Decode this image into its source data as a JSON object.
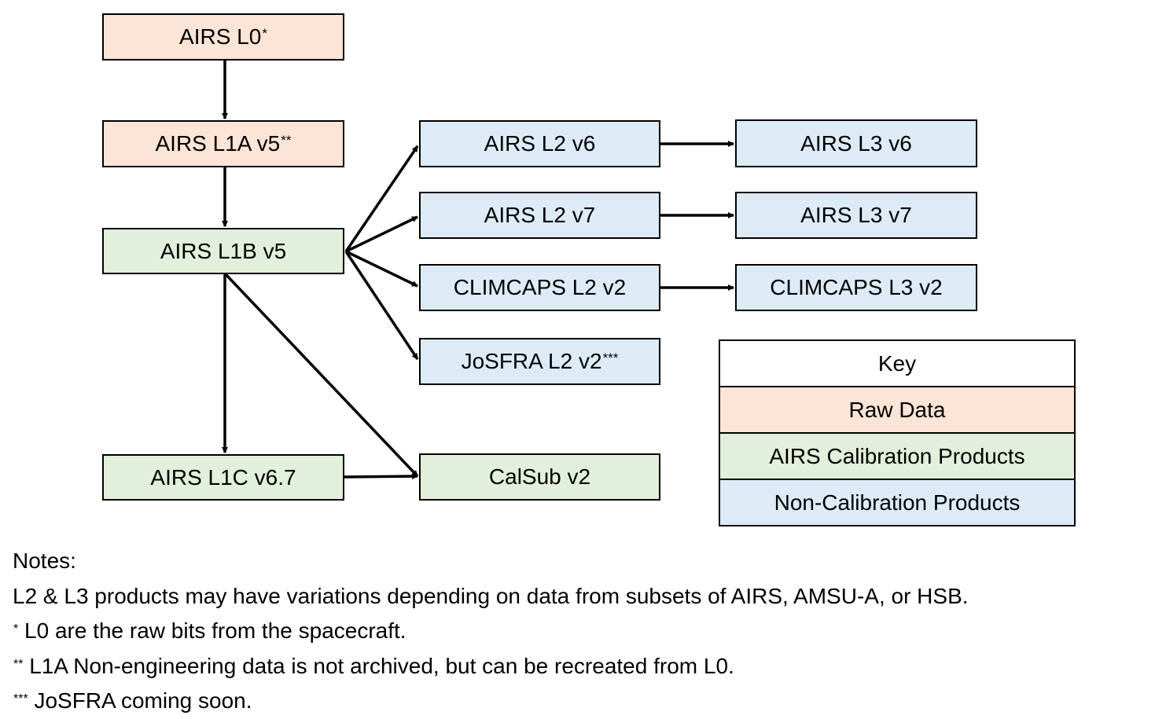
{
  "colors": {
    "raw": "#FCE4D6",
    "calibration": "#E2EFDA",
    "non_calibration": "#DDEBF7"
  },
  "nodes": {
    "l0": {
      "label": "AIRS L0",
      "mark": "*"
    },
    "l1a": {
      "label": "AIRS L1A v5",
      "mark": "**"
    },
    "l1b": {
      "label": "AIRS L1B v5"
    },
    "l1c": {
      "label": "AIRS L1C v6.7"
    },
    "l2v6": {
      "label": "AIRS L2 v6"
    },
    "l2v7": {
      "label": "AIRS L2 v7"
    },
    "climcaps_l2": {
      "label": "CLIMCAPS L2 v2"
    },
    "josfra": {
      "label": "JoSFRA L2 v2",
      "mark": "***"
    },
    "calsub": {
      "label": "CalSub v2"
    },
    "l3v6": {
      "label": "AIRS L3 v6"
    },
    "l3v7": {
      "label": "AIRS L3 v7"
    },
    "climcaps_l3": {
      "label": "CLIMCAPS L3 v2"
    }
  },
  "key": {
    "title": "Key",
    "items": [
      "Raw Data",
      "AIRS Calibration Products",
      "Non-Calibration Products"
    ]
  },
  "notes": {
    "heading": "Notes:",
    "line1": "L2 & L3 products may have variations depending on data from subsets of AIRS, AMSU-A, or HSB.",
    "n1_mark": "*",
    "n1": " L0 are the raw bits from the spacecraft.",
    "n2_mark": "**",
    "n2": " L1A Non-engineering data is not archived, but can be recreated from L0.",
    "n3_mark": "***",
    "n3": " JoSFRA coming soon."
  }
}
